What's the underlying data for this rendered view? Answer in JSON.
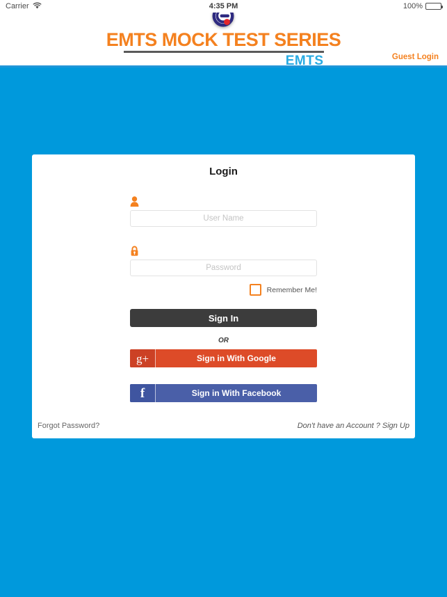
{
  "status_bar": {
    "carrier": "Carrier",
    "wifi_icon": "wifi-icon",
    "time": "4:35 PM",
    "battery_percent": "100%",
    "battery_icon": "battery-full-icon"
  },
  "header": {
    "emblem_icon": "emts-e-emblem-icon",
    "wordmark": "EMTS MOCK TEST SERIES",
    "sub_wordmark": "EMTS",
    "guest_login_label": "Guest Login",
    "brand_orange": "#F4811F",
    "brand_blue": "#29ABE2",
    "rule_blue": "#2196d8"
  },
  "login_card": {
    "title": "Login",
    "username": {
      "icon": "user-icon",
      "value": "",
      "placeholder": "User Name"
    },
    "password": {
      "icon": "lock-icon",
      "value": "",
      "placeholder": "Password"
    },
    "remember_me": {
      "label": "Remember Me!",
      "checked": false
    },
    "sign_in_label": "Sign In",
    "or_label": "OR",
    "google": {
      "icon_glyph": "g+",
      "label": "Sign in With Google",
      "color": "#DD4B28"
    },
    "facebook": {
      "icon_glyph": "f",
      "label": "Sign in With Facebook",
      "color": "#4A5FA8"
    },
    "forgot_password_label": "Forgot Password?",
    "signup_label": "Don't have an Account ? Sign Up"
  },
  "theme": {
    "page_background": "#0099DC",
    "card_background": "#FFFFFF",
    "signin_button": "#3C3C3C",
    "accent_orange": "#F4811F"
  }
}
